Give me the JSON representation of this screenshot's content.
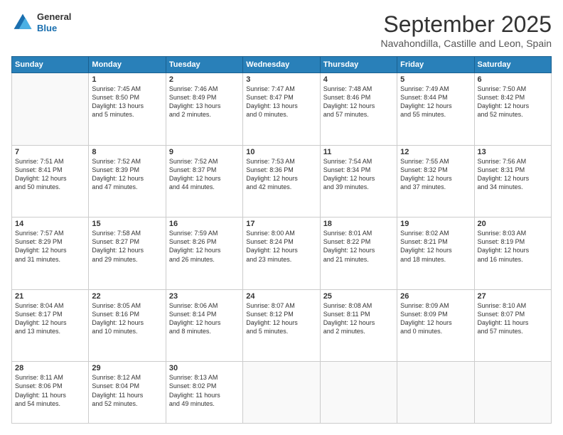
{
  "header": {
    "logo": {
      "general": "General",
      "blue": "Blue"
    },
    "title": "September 2025",
    "location": "Navahondilla, Castille and Leon, Spain"
  },
  "weekdays": [
    "Sunday",
    "Monday",
    "Tuesday",
    "Wednesday",
    "Thursday",
    "Friday",
    "Saturday"
  ],
  "weeks": [
    [
      {
        "day": "",
        "info": ""
      },
      {
        "day": "1",
        "info": "Sunrise: 7:45 AM\nSunset: 8:50 PM\nDaylight: 13 hours\nand 5 minutes."
      },
      {
        "day": "2",
        "info": "Sunrise: 7:46 AM\nSunset: 8:49 PM\nDaylight: 13 hours\nand 2 minutes."
      },
      {
        "day": "3",
        "info": "Sunrise: 7:47 AM\nSunset: 8:47 PM\nDaylight: 13 hours\nand 0 minutes."
      },
      {
        "day": "4",
        "info": "Sunrise: 7:48 AM\nSunset: 8:46 PM\nDaylight: 12 hours\nand 57 minutes."
      },
      {
        "day": "5",
        "info": "Sunrise: 7:49 AM\nSunset: 8:44 PM\nDaylight: 12 hours\nand 55 minutes."
      },
      {
        "day": "6",
        "info": "Sunrise: 7:50 AM\nSunset: 8:42 PM\nDaylight: 12 hours\nand 52 minutes."
      }
    ],
    [
      {
        "day": "7",
        "info": "Sunrise: 7:51 AM\nSunset: 8:41 PM\nDaylight: 12 hours\nand 50 minutes."
      },
      {
        "day": "8",
        "info": "Sunrise: 7:52 AM\nSunset: 8:39 PM\nDaylight: 12 hours\nand 47 minutes."
      },
      {
        "day": "9",
        "info": "Sunrise: 7:52 AM\nSunset: 8:37 PM\nDaylight: 12 hours\nand 44 minutes."
      },
      {
        "day": "10",
        "info": "Sunrise: 7:53 AM\nSunset: 8:36 PM\nDaylight: 12 hours\nand 42 minutes."
      },
      {
        "day": "11",
        "info": "Sunrise: 7:54 AM\nSunset: 8:34 PM\nDaylight: 12 hours\nand 39 minutes."
      },
      {
        "day": "12",
        "info": "Sunrise: 7:55 AM\nSunset: 8:32 PM\nDaylight: 12 hours\nand 37 minutes."
      },
      {
        "day": "13",
        "info": "Sunrise: 7:56 AM\nSunset: 8:31 PM\nDaylight: 12 hours\nand 34 minutes."
      }
    ],
    [
      {
        "day": "14",
        "info": "Sunrise: 7:57 AM\nSunset: 8:29 PM\nDaylight: 12 hours\nand 31 minutes."
      },
      {
        "day": "15",
        "info": "Sunrise: 7:58 AM\nSunset: 8:27 PM\nDaylight: 12 hours\nand 29 minutes."
      },
      {
        "day": "16",
        "info": "Sunrise: 7:59 AM\nSunset: 8:26 PM\nDaylight: 12 hours\nand 26 minutes."
      },
      {
        "day": "17",
        "info": "Sunrise: 8:00 AM\nSunset: 8:24 PM\nDaylight: 12 hours\nand 23 minutes."
      },
      {
        "day": "18",
        "info": "Sunrise: 8:01 AM\nSunset: 8:22 PM\nDaylight: 12 hours\nand 21 minutes."
      },
      {
        "day": "19",
        "info": "Sunrise: 8:02 AM\nSunset: 8:21 PM\nDaylight: 12 hours\nand 18 minutes."
      },
      {
        "day": "20",
        "info": "Sunrise: 8:03 AM\nSunset: 8:19 PM\nDaylight: 12 hours\nand 16 minutes."
      }
    ],
    [
      {
        "day": "21",
        "info": "Sunrise: 8:04 AM\nSunset: 8:17 PM\nDaylight: 12 hours\nand 13 minutes."
      },
      {
        "day": "22",
        "info": "Sunrise: 8:05 AM\nSunset: 8:16 PM\nDaylight: 12 hours\nand 10 minutes."
      },
      {
        "day": "23",
        "info": "Sunrise: 8:06 AM\nSunset: 8:14 PM\nDaylight: 12 hours\nand 8 minutes."
      },
      {
        "day": "24",
        "info": "Sunrise: 8:07 AM\nSunset: 8:12 PM\nDaylight: 12 hours\nand 5 minutes."
      },
      {
        "day": "25",
        "info": "Sunrise: 8:08 AM\nSunset: 8:11 PM\nDaylight: 12 hours\nand 2 minutes."
      },
      {
        "day": "26",
        "info": "Sunrise: 8:09 AM\nSunset: 8:09 PM\nDaylight: 12 hours\nand 0 minutes."
      },
      {
        "day": "27",
        "info": "Sunrise: 8:10 AM\nSunset: 8:07 PM\nDaylight: 11 hours\nand 57 minutes."
      }
    ],
    [
      {
        "day": "28",
        "info": "Sunrise: 8:11 AM\nSunset: 8:06 PM\nDaylight: 11 hours\nand 54 minutes."
      },
      {
        "day": "29",
        "info": "Sunrise: 8:12 AM\nSunset: 8:04 PM\nDaylight: 11 hours\nand 52 minutes."
      },
      {
        "day": "30",
        "info": "Sunrise: 8:13 AM\nSunset: 8:02 PM\nDaylight: 11 hours\nand 49 minutes."
      },
      {
        "day": "",
        "info": ""
      },
      {
        "day": "",
        "info": ""
      },
      {
        "day": "",
        "info": ""
      },
      {
        "day": "",
        "info": ""
      }
    ]
  ]
}
